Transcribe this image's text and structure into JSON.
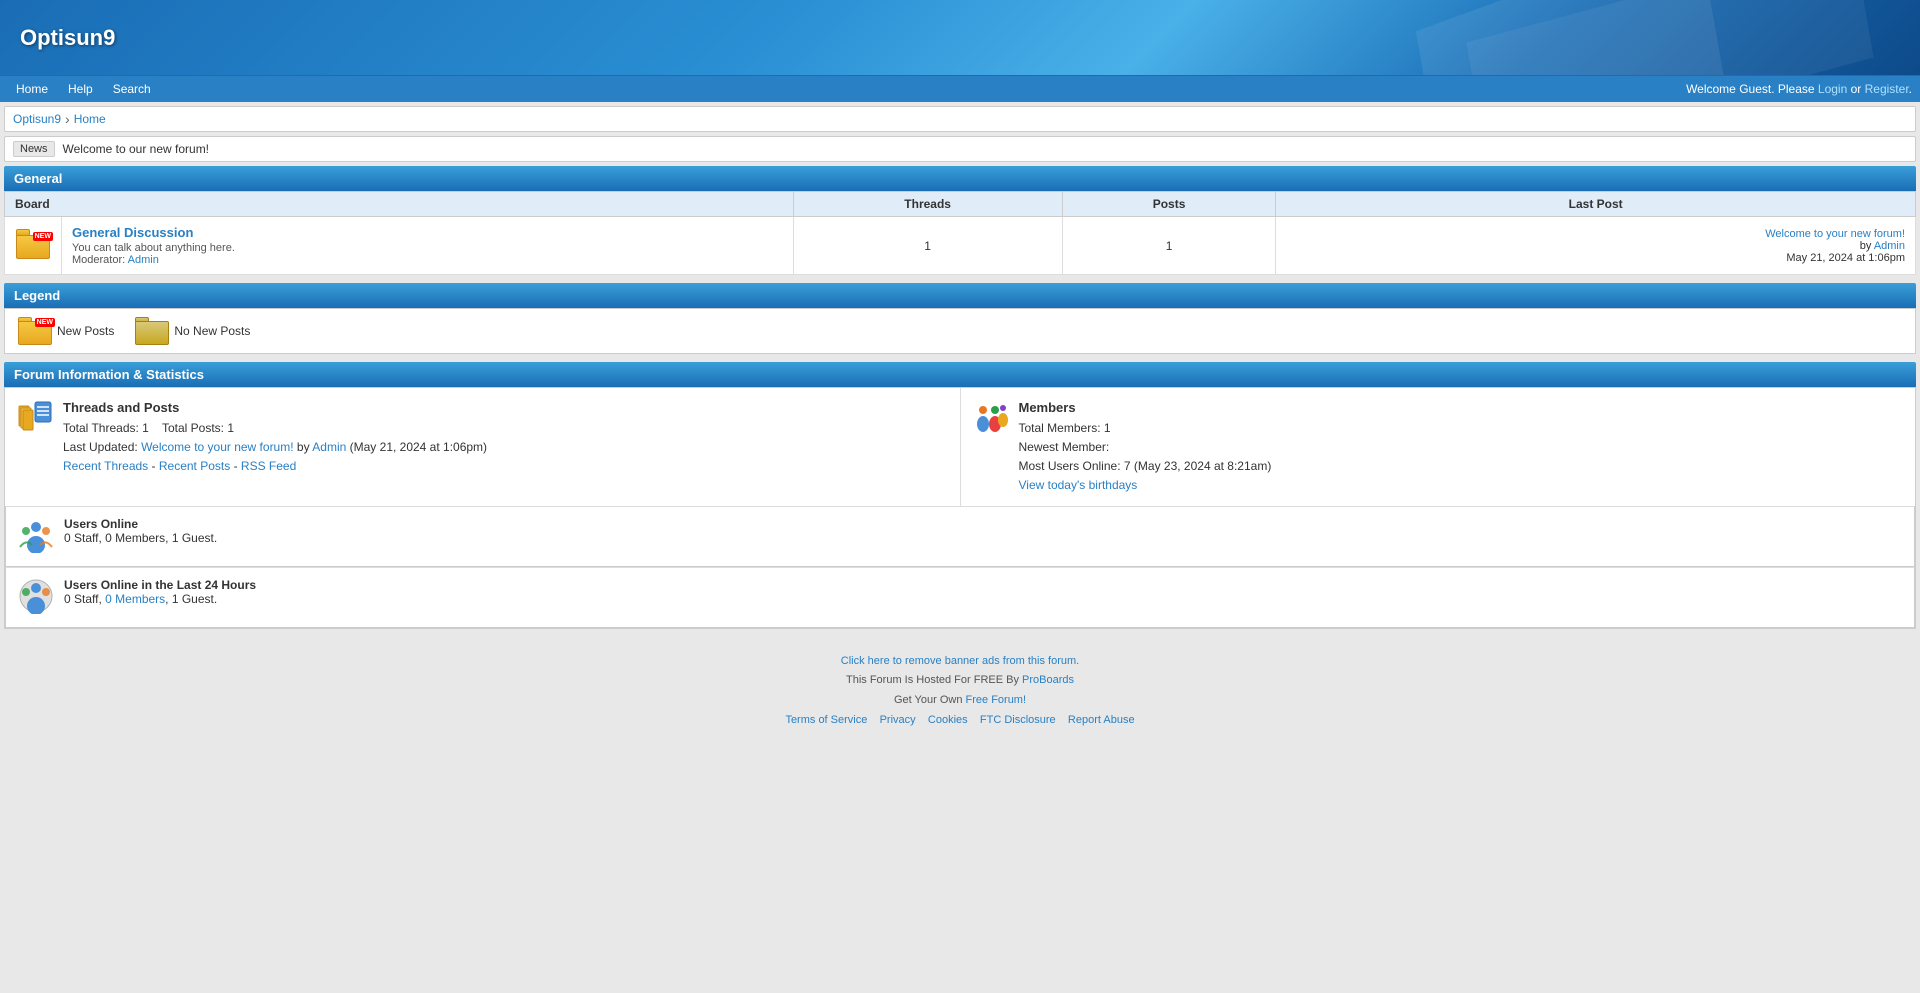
{
  "site": {
    "title": "Optisun9"
  },
  "nav": {
    "links": [
      {
        "label": "Home",
        "href": "#"
      },
      {
        "label": "Help",
        "href": "#"
      },
      {
        "label": "Search",
        "href": "#"
      }
    ],
    "welcome_prefix": "Welcome Guest. Please ",
    "login_label": "Login",
    "or_text": " or ",
    "register_label": "Register",
    "welcome_suffix": "."
  },
  "breadcrumb": {
    "items": [
      {
        "label": "Optisun9",
        "href": "#"
      },
      {
        "label": "Home",
        "href": "#"
      }
    ]
  },
  "news": {
    "label": "News",
    "text": "Welcome to our new forum!"
  },
  "general_section": {
    "title": "General",
    "columns": {
      "board": "Board",
      "threads": "Threads",
      "posts": "Posts",
      "last_post": "Last Post"
    },
    "boards": [
      {
        "name": "General Discussion",
        "description": "You can talk about anything here.",
        "moderator_label": "Moderator:",
        "moderator": "Admin",
        "threads": "1",
        "posts": "1",
        "last_post_link": "Welcome to your new forum!",
        "last_post_by": "by",
        "last_post_author": "Admin",
        "last_post_date": "May 21, 2024 at 1:06pm"
      }
    ]
  },
  "legend_section": {
    "title": "Legend",
    "items": [
      {
        "label": "New Posts"
      },
      {
        "label": "No New Posts"
      }
    ]
  },
  "stats_section": {
    "title": "Forum Information & Statistics",
    "threads_posts": {
      "heading": "Threads and Posts",
      "total_threads_label": "Total Threads:",
      "total_threads": "1",
      "total_posts_label": "Total Posts:",
      "total_posts": "1",
      "last_updated_label": "Last Updated:",
      "last_updated_link": "Welcome to your new forum!",
      "last_updated_by": "by",
      "last_updated_author": "Admin",
      "last_updated_date": "(May 21, 2024 at 1:06pm)",
      "recent_threads_label": "Recent Threads",
      "separator": "-",
      "recent_posts_label": "Recent Posts",
      "separator2": "-",
      "rss_label": "RSS Feed"
    },
    "members": {
      "heading": "Members",
      "total_members_label": "Total Members:",
      "total_members": "1",
      "newest_member_label": "Newest Member:",
      "newest_member": "",
      "most_users_label": "Most Users Online:",
      "most_users": "7",
      "most_users_date": "(May 23, 2024 at 8:21am)",
      "view_birthdays_label": "View today's birthdays"
    }
  },
  "users_online": {
    "heading": "Users Online",
    "text": "0 Staff, 0 Members, 1 Guest."
  },
  "users_online_24": {
    "heading": "Users Online in the Last 24 Hours",
    "text_prefix": "0 Staff, ",
    "members_link": "0 Members",
    "text_suffix": ", 1 Guest."
  },
  "footer": {
    "remove_ads": "Click here to remove banner ads from this forum.",
    "hosted_text": "This Forum Is Hosted For FREE By ",
    "hosted_link": "ProBoards",
    "get_forum_text": "Get Your Own ",
    "get_forum_link": "Free Forum!",
    "links": [
      {
        "label": "Terms of Service"
      },
      {
        "label": "Privacy"
      },
      {
        "label": "Cookies"
      },
      {
        "label": "FTC Disclosure"
      },
      {
        "label": "Report Abuse"
      }
    ]
  }
}
